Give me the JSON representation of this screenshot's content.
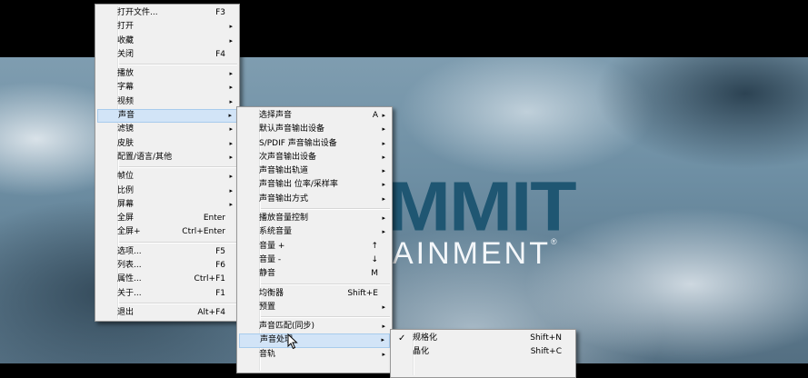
{
  "video": {
    "logo_line1": "MMIT",
    "logo_line2": "AINMENT",
    "logo_mark": "®"
  },
  "main_menu": [
    {
      "label": "打开文件...",
      "key": "F3"
    },
    {
      "label": "打开",
      "arrow": "▸"
    },
    {
      "label": "收藏",
      "arrow": "▸"
    },
    {
      "label": "关闭",
      "key": "F4"
    },
    {
      "sep": true
    },
    {
      "label": "播放",
      "arrow": "▸"
    },
    {
      "label": "字幕",
      "arrow": "▸"
    },
    {
      "label": "视频",
      "arrow": "▸"
    },
    {
      "label": "声音",
      "arrow": "▸",
      "highlighted": true
    },
    {
      "label": "滤镜",
      "arrow": "▸"
    },
    {
      "label": "皮肤",
      "arrow": "▸"
    },
    {
      "label": "配置/语言/其他",
      "arrow": "▸"
    },
    {
      "sep": true
    },
    {
      "label": "帧位",
      "arrow": "▸"
    },
    {
      "label": "比例",
      "arrow": "▸"
    },
    {
      "label": "屏幕",
      "arrow": "▸"
    },
    {
      "label": "全屏",
      "key": "Enter"
    },
    {
      "label": "全屏+",
      "key": "Ctrl+Enter"
    },
    {
      "sep": true
    },
    {
      "label": "选项...",
      "key": "F5"
    },
    {
      "label": "列表...",
      "key": "F6"
    },
    {
      "label": "属性...",
      "key": "Ctrl+F1"
    },
    {
      "label": "关于...",
      "key": "F1"
    },
    {
      "sep": true
    },
    {
      "label": "退出",
      "key": "Alt+F4"
    }
  ],
  "sound_menu": [
    {
      "label": "选择声音",
      "key": "A",
      "arrow": "▸"
    },
    {
      "label": "默认声音输出设备",
      "arrow": "▸"
    },
    {
      "label": "S/PDIF 声音输出设备",
      "arrow": "▸"
    },
    {
      "label": "次声音输出设备",
      "arrow": "▸"
    },
    {
      "label": "声音输出轨道",
      "arrow": "▸"
    },
    {
      "label": "声音输出 位率/采样率",
      "arrow": "▸"
    },
    {
      "label": "声音输出方式",
      "arrow": "▸"
    },
    {
      "sep": true
    },
    {
      "label": "播放音量控制",
      "arrow": "▸"
    },
    {
      "label": "系统音量",
      "arrow": "▸"
    },
    {
      "label": "音量 +",
      "key": "↑"
    },
    {
      "label": "音量 -",
      "key": "↓"
    },
    {
      "label": "静音",
      "key": "M"
    },
    {
      "sep": true
    },
    {
      "label": "均衡器",
      "key": "Shift+E"
    },
    {
      "label": "预置",
      "arrow": "▸"
    },
    {
      "sep": true
    },
    {
      "label": "声音匹配(同步)",
      "arrow": "▸"
    },
    {
      "label": "声音处理",
      "arrow": "▸",
      "highlighted": true
    },
    {
      "label": "音轨",
      "arrow": "▸"
    }
  ],
  "processing_menu": [
    {
      "label": "规格化",
      "key": "Shift+N",
      "checked": true,
      "check": "✓"
    },
    {
      "label": "晶化",
      "key": "Shift+C"
    },
    {
      "label": "",
      "key": ""
    }
  ]
}
